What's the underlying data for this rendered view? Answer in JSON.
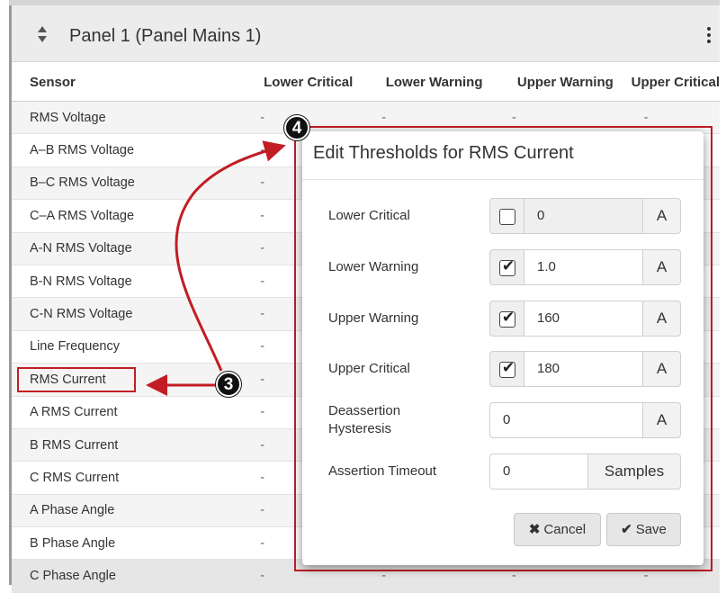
{
  "panel": {
    "title": "Panel 1 (Panel Mains 1)"
  },
  "table": {
    "columns": [
      "Sensor",
      "Lower Critical",
      "Lower Warning",
      "Upper Warning",
      "Upper Critical"
    ],
    "rows": [
      {
        "sensor": "RMS Voltage",
        "lc": "-",
        "lw": "-",
        "uw": "-",
        "uc": "-"
      },
      {
        "sensor": "A–B RMS Voltage",
        "lc": "-",
        "lw": "",
        "uw": "",
        "uc": ""
      },
      {
        "sensor": "B–C RMS Voltage",
        "lc": "-",
        "lw": "",
        "uw": "",
        "uc": ""
      },
      {
        "sensor": "C–A RMS Voltage",
        "lc": "-",
        "lw": "",
        "uw": "",
        "uc": ""
      },
      {
        "sensor": "A-N RMS Voltage",
        "lc": "-",
        "lw": "",
        "uw": "",
        "uc": ""
      },
      {
        "sensor": "B-N RMS Voltage",
        "lc": "-",
        "lw": "",
        "uw": "",
        "uc": ""
      },
      {
        "sensor": "C-N RMS Voltage",
        "lc": "-",
        "lw": "",
        "uw": "",
        "uc": ""
      },
      {
        "sensor": "Line Frequency",
        "lc": "-",
        "lw": "",
        "uw": "",
        "uc": ""
      },
      {
        "sensor": "RMS Current",
        "lc": "-",
        "lw": "",
        "uw": "",
        "uc": ""
      },
      {
        "sensor": "A RMS Current",
        "lc": "-",
        "lw": "",
        "uw": "",
        "uc": ""
      },
      {
        "sensor": "B RMS Current",
        "lc": "-",
        "lw": "",
        "uw": "",
        "uc": ""
      },
      {
        "sensor": "C RMS Current",
        "lc": "-",
        "lw": "",
        "uw": "",
        "uc": ""
      },
      {
        "sensor": "A Phase Angle",
        "lc": "-",
        "lw": "",
        "uw": "",
        "uc": ""
      },
      {
        "sensor": "B Phase Angle",
        "lc": "-",
        "lw": "",
        "uw": "",
        "uc": ""
      },
      {
        "sensor": "C Phase Angle",
        "lc": "-",
        "lw": "-",
        "uw": "-",
        "uc": "-"
      }
    ]
  },
  "modal": {
    "title": "Edit Thresholds for RMS Current",
    "fields": {
      "lower_critical": {
        "label": "Lower Critical",
        "enabled": false,
        "value": "0",
        "unit": "A"
      },
      "lower_warning": {
        "label": "Lower Warning",
        "enabled": true,
        "value": "1.0",
        "unit": "A"
      },
      "upper_warning": {
        "label": "Upper Warning",
        "enabled": true,
        "value": "160",
        "unit": "A"
      },
      "upper_critical": {
        "label": "Upper Critical",
        "enabled": true,
        "value": "180",
        "unit": "A"
      },
      "deassertion_hysteresis": {
        "label_line1": "Deassertion",
        "label_line2": "Hysteresis",
        "value": "0",
        "unit": "A"
      },
      "assertion_timeout": {
        "label": "Assertion Timeout",
        "value": "0",
        "unit": "Samples"
      }
    },
    "cancel_label": "Cancel",
    "save_label": "Save",
    "check_glyph": "✔"
  },
  "annotations": {
    "step3": "3",
    "step4": "4",
    "color": "#c21d25"
  },
  "icons": {
    "sort": "sort-icon",
    "menu": "kebab-menu-icon",
    "cancel": "x-icon",
    "save": "checkmark-icon"
  }
}
